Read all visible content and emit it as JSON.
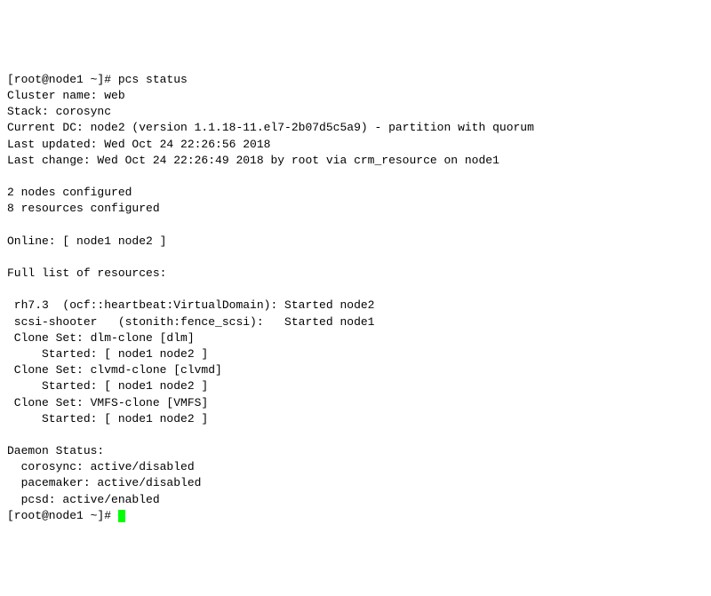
{
  "prompt1": "[root@node1 ~]# ",
  "cmd1": "pcs status",
  "clusterName": "Cluster name: web",
  "stack": "Stack: corosync",
  "currentDC": "Current DC: node2 (version 1.1.18-11.el7-2b07d5c5a9) - partition with quorum",
  "lastUpdated": "Last updated: Wed Oct 24 22:26:56 2018",
  "lastChange": "Last change: Wed Oct 24 22:26:49 2018 by root via crm_resource on node1",
  "nodesConfigured": "2 nodes configured",
  "resourcesConfigured": "8 resources configured",
  "online": "Online: [ node1 node2 ]",
  "fullListHeader": "Full list of resources:",
  "res_rh73": " rh7.3  (ocf::heartbeat:VirtualDomain): Started node2",
  "res_scsi": " scsi-shooter   (stonith:fence_scsi):   Started node1",
  "clone_dlm": " Clone Set: dlm-clone [dlm]",
  "clone_dlm_started": "     Started: [ node1 node2 ]",
  "clone_clvmd": " Clone Set: clvmd-clone [clvmd]",
  "clone_clvmd_started": "     Started: [ node1 node2 ]",
  "clone_vmfs": " Clone Set: VMFS-clone [VMFS]",
  "clone_vmfs_started": "     Started: [ node1 node2 ]",
  "daemonHeader": "Daemon Status:",
  "daemon_corosync": "  corosync: active/disabled",
  "daemon_pacemaker": "  pacemaker: active/disabled",
  "daemon_pcsd": "  pcsd: active/enabled",
  "prompt2": "[root@node1 ~]# "
}
